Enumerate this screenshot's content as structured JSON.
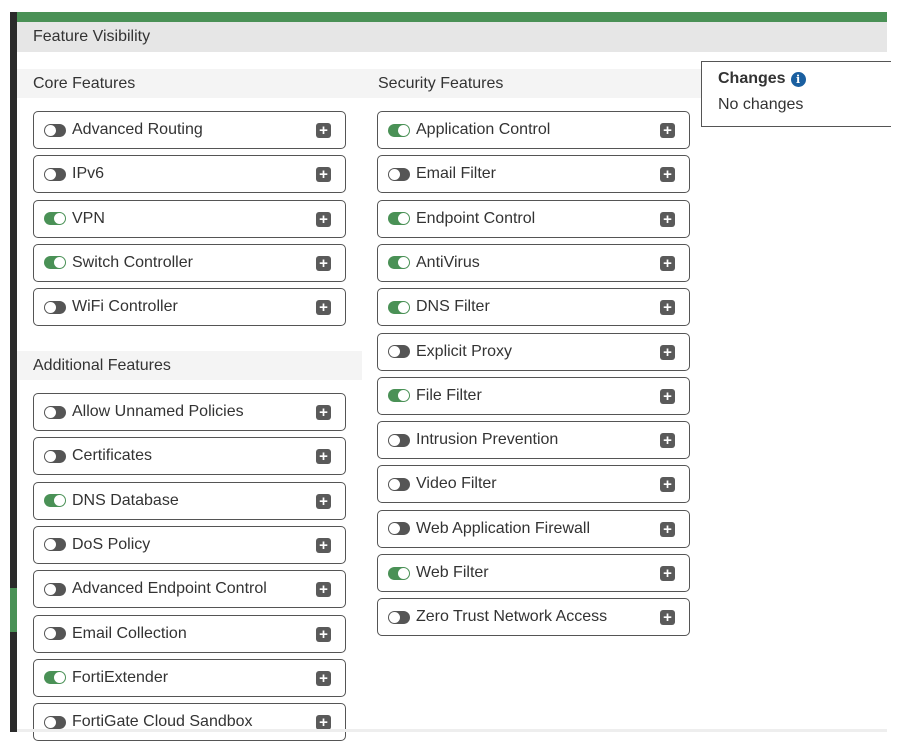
{
  "header": {
    "title": "Feature Visibility"
  },
  "core": {
    "title": "Core Features",
    "items": [
      {
        "label": "Advanced Routing",
        "on": false
      },
      {
        "label": "IPv6",
        "on": false
      },
      {
        "label": "VPN",
        "on": true
      },
      {
        "label": "Switch Controller",
        "on": true
      },
      {
        "label": "WiFi Controller",
        "on": false
      }
    ]
  },
  "additional": {
    "title": "Additional Features",
    "items": [
      {
        "label": "Allow Unnamed Policies",
        "on": false
      },
      {
        "label": "Certificates",
        "on": false
      },
      {
        "label": "DNS Database",
        "on": true
      },
      {
        "label": "DoS Policy",
        "on": false
      },
      {
        "label": "Advanced Endpoint Control",
        "on": false
      },
      {
        "label": "Email Collection",
        "on": false
      },
      {
        "label": "FortiExtender",
        "on": true
      },
      {
        "label": "FortiGate Cloud Sandbox",
        "on": false
      }
    ]
  },
  "security": {
    "title": "Security Features",
    "items": [
      {
        "label": "Application Control",
        "on": true
      },
      {
        "label": "Email Filter",
        "on": false
      },
      {
        "label": "Endpoint Control",
        "on": true
      },
      {
        "label": "AntiVirus",
        "on": true
      },
      {
        "label": "DNS Filter",
        "on": true
      },
      {
        "label": "Explicit Proxy",
        "on": false
      },
      {
        "label": "File Filter",
        "on": true
      },
      {
        "label": "Intrusion Prevention",
        "on": false
      },
      {
        "label": "Video Filter",
        "on": false
      },
      {
        "label": "Web Application Firewall",
        "on": false
      },
      {
        "label": "Web Filter",
        "on": true
      },
      {
        "label": "Zero Trust Network Access",
        "on": false
      }
    ]
  },
  "changes": {
    "title": "Changes",
    "info_icon": "i",
    "status": "No changes"
  },
  "colors": {
    "accent": "#4a9156",
    "info": "#1a5fa0"
  }
}
